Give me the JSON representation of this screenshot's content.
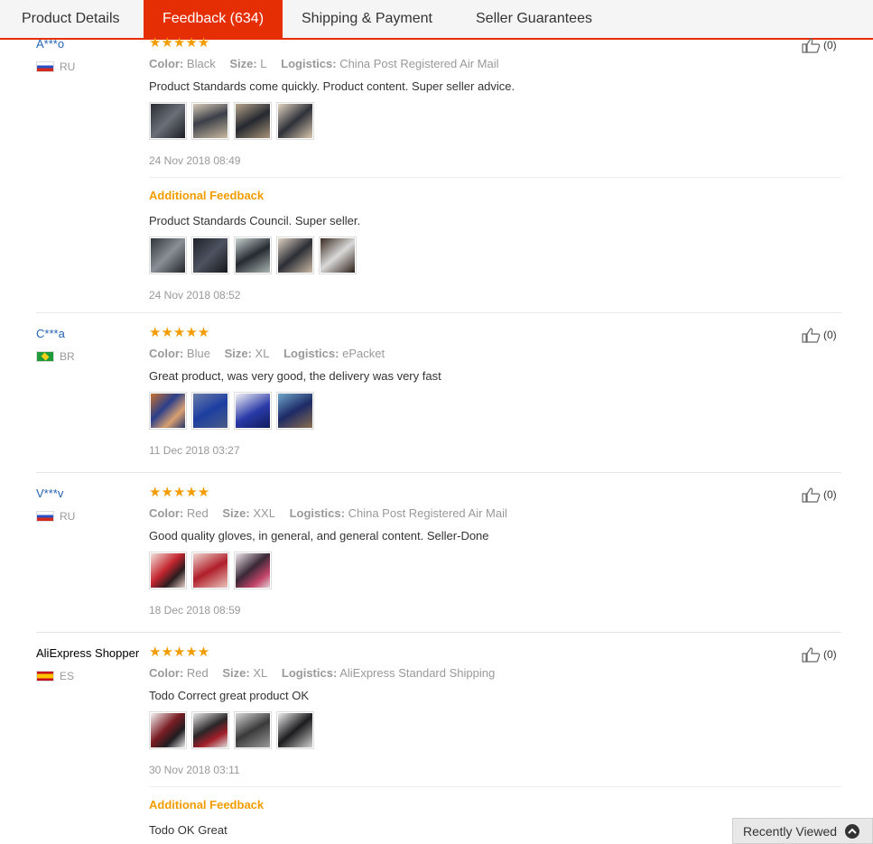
{
  "tabs": [
    {
      "label": "Product Details"
    },
    {
      "label": "Feedback (634)"
    },
    {
      "label": "Shipping & Payment"
    },
    {
      "label": "Seller Guarantees"
    }
  ],
  "labels": {
    "color": "Color:",
    "size": "Size:",
    "logistics": "Logistics:",
    "additional_feedback": "Additional Feedback",
    "stars": "★★★★★"
  },
  "colors": {
    "accent": "#e62e04",
    "star": "#f39c00",
    "username": "#2463b3",
    "meta": "#999999"
  },
  "reviews": [
    {
      "user": "A***o",
      "country": "RU",
      "color": "Black",
      "size": "L",
      "logistics": "China Post Registered Air Mail",
      "text": "Product Standards come quickly. Product content. Super seller advice.",
      "date": "24 Nov 2018 08:49",
      "likes": "(0)",
      "photo_count": 4,
      "additional": {
        "text": "Product Standards Council. Super seller.",
        "date": "24 Nov 2018 08:52",
        "photo_count": 5
      }
    },
    {
      "user": "C***a",
      "country": "BR",
      "color": "Blue",
      "size": "XL",
      "logistics": "ePacket",
      "text": "Great product, was very good, the delivery was very fast",
      "date": "11 Dec 2018 03:27",
      "likes": "(0)",
      "photo_count": 4
    },
    {
      "user": "V***v",
      "country": "RU",
      "color": "Red",
      "size": "XXL",
      "logistics": "China Post Registered Air Mail",
      "text": "Good quality gloves, in general, and general content. Seller-Done",
      "date": "18 Dec 2018 08:59",
      "likes": "(0)",
      "photo_count": 3
    },
    {
      "user": "AliExpress Shopper",
      "country": "ES",
      "color": "Red",
      "size": "XL",
      "logistics": "AliExpress Standard Shipping",
      "text": "Todo Correct great product OK",
      "date": "30 Nov 2018 03:11",
      "likes": "(0)",
      "photo_count": 4,
      "additional": {
        "text": "Todo OK Great"
      }
    }
  ],
  "recently_viewed": {
    "label": "Recently Viewed",
    "icon": "chevron-up-icon"
  }
}
